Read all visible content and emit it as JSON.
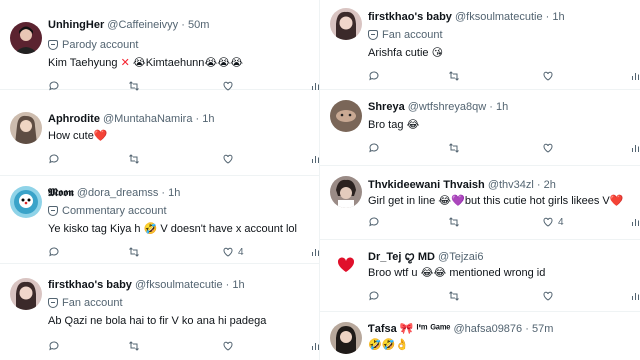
{
  "left_column": [
    {
      "name": "UnhingHer",
      "handle": "@Caffeineivyy",
      "time": "· 50m",
      "badge": "Parody account",
      "text": "Kim Taehyung",
      "text_suffix": "😭Kimtaehunn😭😭😭",
      "likes": "",
      "avatar_color": "#5b2330"
    },
    {
      "name": "Aphrodite",
      "handle": "@MuntahaNamira",
      "time": "· 1h",
      "badge": "",
      "text": "How cute",
      "text_suffix": "❤️",
      "likes": "",
      "avatar_color": "#c9b8a8"
    },
    {
      "name": "𝕸𝖔𝖔𝖓",
      "handle": "@dora_dreamss",
      "time": "· 1h",
      "badge": "Commentary account",
      "text": "Ye kisko tag Kiya h 🤣 V doesn't have x account lol",
      "text_suffix": "",
      "likes": "4",
      "avatar_color": "#3aa3c9"
    },
    {
      "name": "firstkhao's baby",
      "handle": "@fksoulmatecutie",
      "time": "· 1h",
      "badge": "Fan account",
      "text": "Ab Qazi ne bola hai to fir V ko ana hi padega",
      "text_suffix": "",
      "likes": "",
      "avatar_color": "#c4a5a8"
    }
  ],
  "right_column": [
    {
      "name": "firstkhao's baby",
      "handle": "@fksoulmatecutie",
      "time": "· 1h",
      "badge": "Fan account",
      "text": "Arishfa cutie 😘",
      "text_suffix": "",
      "likes": "",
      "avatar_color": "#c4a5a8"
    },
    {
      "name": "Shreya",
      "handle": "@wtfshreya8qw",
      "time": "· 1h",
      "badge": "",
      "text": "Bro tag 😂",
      "text_suffix": "",
      "likes": "",
      "avatar_color": "#6b5a4e"
    },
    {
      "name": "Thvkideewani Thvaish",
      "handle": "@thv34zl",
      "time": "· 2h",
      "badge": "",
      "text": "Girl get in line 😂💜but this cutie  hot girls likees V",
      "text_suffix": "❤️",
      "likes": "4",
      "avatar_color": "#8a7a74"
    },
    {
      "name": "Dr_Tej ꨄ︎ MD",
      "handle": "@Tejzai6",
      "time": "· 1h",
      "badge": "",
      "text": "Broo wtf u 😂😂 mentioned wrong id",
      "text_suffix": "",
      "likes": "",
      "avatar_color": "#ffffff"
    },
    {
      "name": "Ƭafsa 🎀 ᴵ'ᵐ ᴳᵃᵐᵉ",
      "handle": "@hafsa09876",
      "time": "· 57m",
      "badge": "",
      "text": "🤣🤣👌",
      "text_suffix": "",
      "likes": "",
      "avatar_color": "#b8a89c"
    }
  ]
}
